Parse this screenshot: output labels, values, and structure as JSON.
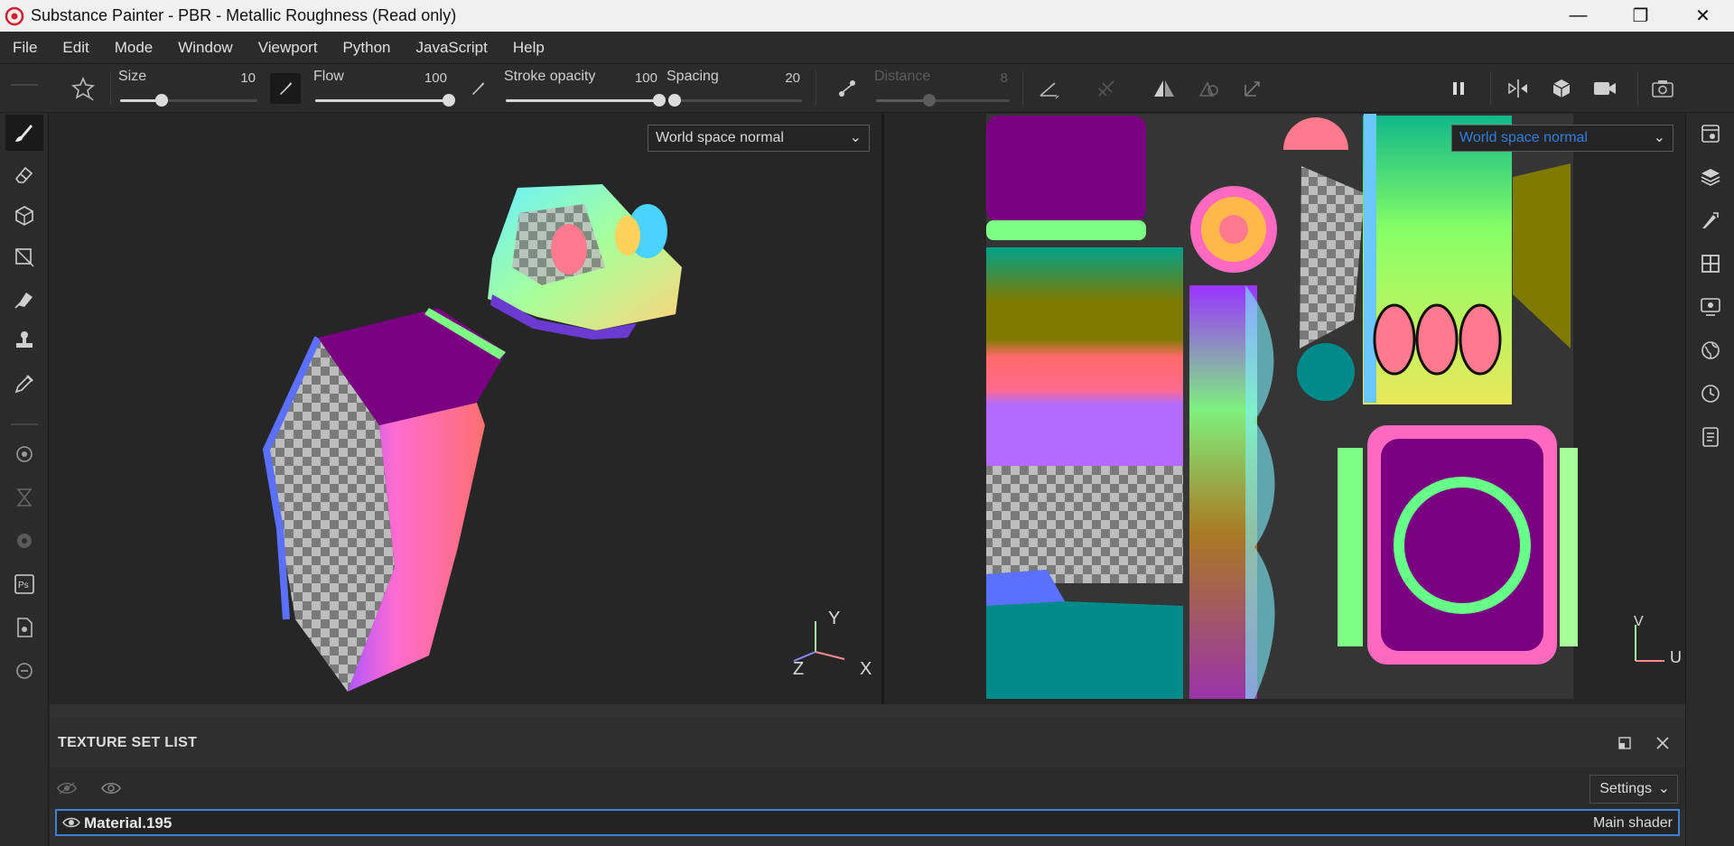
{
  "window": {
    "title": "Substance Painter - PBR - Metallic Roughness (Read only)",
    "controls": [
      "—",
      "❐",
      "✕"
    ]
  },
  "menu": [
    "File",
    "Edit",
    "Mode",
    "Window",
    "Viewport",
    "Python",
    "JavaScript",
    "Help"
  ],
  "toolbar": {
    "size": {
      "label": "Size",
      "value": "10",
      "fraction": 0.3
    },
    "flow": {
      "label": "Flow",
      "value": "100",
      "fraction": 1.0
    },
    "stroke_opacity": {
      "label": "Stroke opacity",
      "value": "100",
      "fraction": 1.0
    },
    "spacing": {
      "label": "Spacing",
      "value": "20",
      "fraction": 0.05
    },
    "distance": {
      "label": "Distance",
      "value": "8",
      "fraction": 0.4
    }
  },
  "viewport_3d": {
    "mode_select": "World space normal",
    "gizmo": {
      "y": "Y",
      "z": "Z",
      "x": "X"
    }
  },
  "viewport_2d": {
    "mode_select": "World space normal",
    "gizmo": {
      "v": "V",
      "u": "U"
    }
  },
  "texture_set_panel": {
    "title": "TEXTURE SET LIST",
    "settings_label": "Settings",
    "rows": [
      {
        "name": "Material.195",
        "shader": "Main shader"
      }
    ]
  },
  "colors": {
    "accent_selection": "#3b82d8",
    "uv_select_text": "#2f7fe0"
  }
}
